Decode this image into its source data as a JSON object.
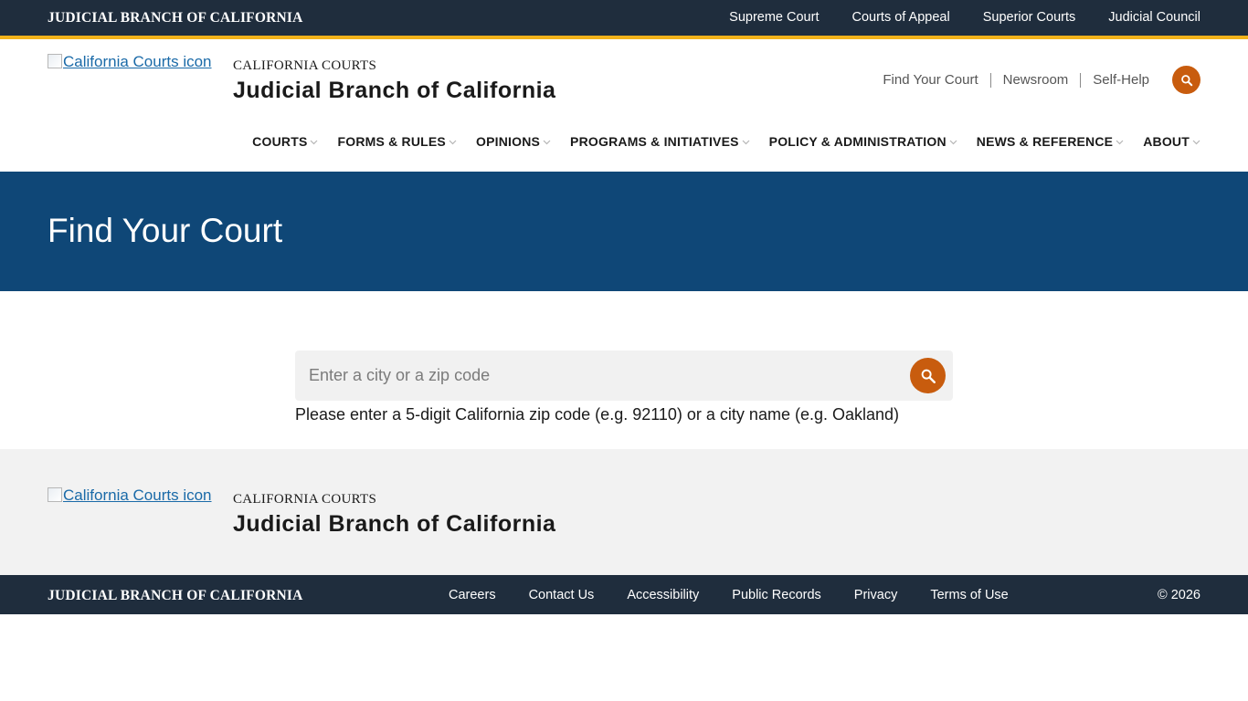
{
  "topbar": {
    "title": "Judicial Branch of California",
    "links": [
      "Supreme Court",
      "Courts of Appeal",
      "Superior Courts",
      "Judicial Council"
    ]
  },
  "header": {
    "logo_alt": "California Courts icon",
    "kicker": "CALIFORNIA COURTS",
    "title": "Judicial Branch of California",
    "utility_links": [
      "Find Your Court",
      "Newsroom",
      "Self-Help"
    ],
    "search_icon": "search-icon"
  },
  "nav": {
    "items": [
      "COURTS",
      "FORMS & RULES",
      "OPINIONS",
      "PROGRAMS & INITIATIVES",
      "POLICY & ADMINISTRATION",
      "NEWS & REFERENCE",
      "ABOUT"
    ],
    "dropdown_icon": "chevron-down-icon"
  },
  "hero": {
    "title": "Find Your Court"
  },
  "finder": {
    "placeholder": "Enter a city or a zip code",
    "value": "",
    "help": "Please enter a 5-digit California zip code (e.g. 92110) or a city name (e.g. Oakland)",
    "button_icon": "search-icon"
  },
  "footer": {
    "logo_alt": "California Courts icon",
    "kicker": "CALIFORNIA COURTS",
    "title": "Judicial Branch of California",
    "bar_title": "Judicial Branch of California",
    "links": [
      "Careers",
      "Contact Us",
      "Accessibility",
      "Public Records",
      "Privacy",
      "Terms of Use"
    ],
    "copyright": "© 2026"
  },
  "colors": {
    "dark_bar": "#1f2d3d",
    "accent_gold": "#f2b21a",
    "hero_blue": "#0f4777",
    "action_orange": "#c85c0e",
    "link_blue": "#1a6aa8"
  }
}
